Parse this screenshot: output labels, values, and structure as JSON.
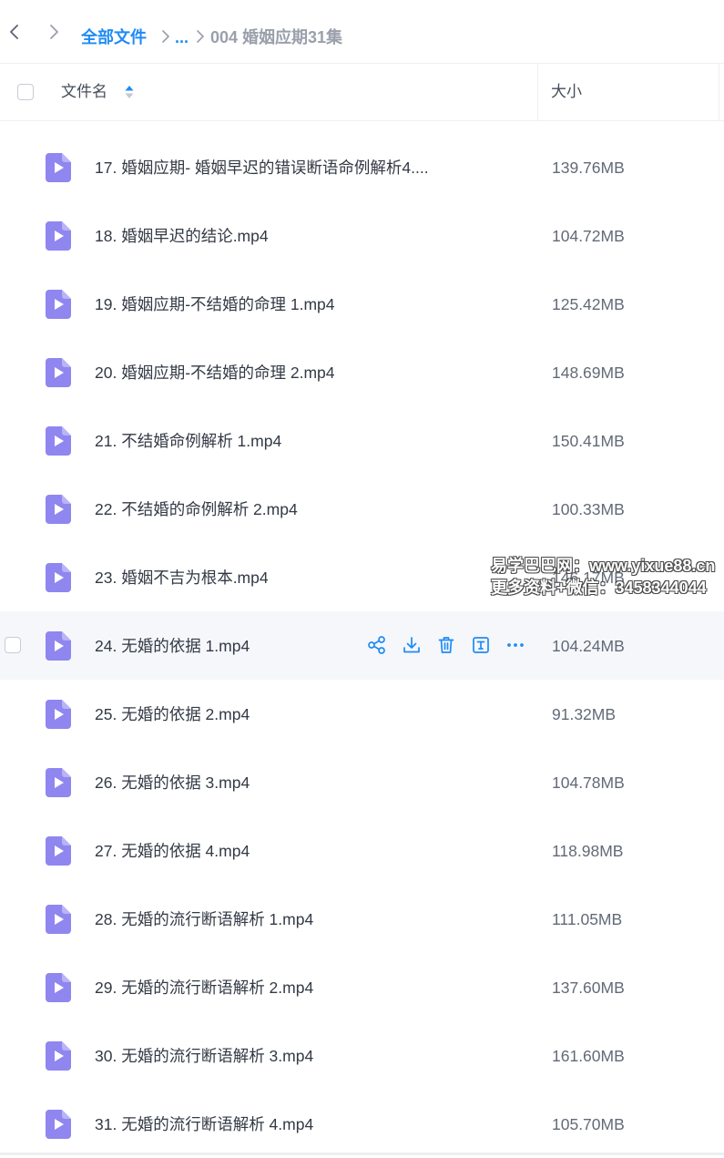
{
  "breadcrumb": {
    "root": "全部文件",
    "ellipsis": "...",
    "current": "004 婚姻应期31集"
  },
  "header": {
    "name_label": "文件名",
    "size_label": "大小"
  },
  "colors": {
    "accent": "#1f8bf5",
    "file_icon": "#8f86f0",
    "hover_row": "#f5f7fb"
  },
  "files": [
    {
      "name": "17. 婚姻应期- 婚姻早迟的错误断语命例解析4....",
      "size": "139.76MB"
    },
    {
      "name": "18. 婚姻早迟的结论.mp4",
      "size": "104.72MB"
    },
    {
      "name": "19. 婚姻应期-不结婚的命理 1.mp4",
      "size": "125.42MB"
    },
    {
      "name": "20. 婚姻应期-不结婚的命理 2.mp4",
      "size": "148.69MB"
    },
    {
      "name": "21. 不结婚命例解析 1.mp4",
      "size": "150.41MB"
    },
    {
      "name": "22. 不结婚的命例解析 2.mp4",
      "size": "100.33MB"
    },
    {
      "name": "23. 婚姻不吉为根本.mp4",
      "size": "146.17MB"
    },
    {
      "name": "24. 无婚的依据 1.mp4",
      "size": "104.24MB"
    },
    {
      "name": "25. 无婚的依据 2.mp4",
      "size": "91.32MB"
    },
    {
      "name": "26. 无婚的依据 3.mp4",
      "size": "104.78MB"
    },
    {
      "name": "27. 无婚的依据 4.mp4",
      "size": "118.98MB"
    },
    {
      "name": "28. 无婚的流行断语解析 1.mp4",
      "size": "111.05MB"
    },
    {
      "name": "29. 无婚的流行断语解析 2.mp4",
      "size": "137.60MB"
    },
    {
      "name": "30. 无婚的流行断语解析 3.mp4",
      "size": "161.60MB"
    },
    {
      "name": "31. 无婚的流行断语解析 4.mp4",
      "size": "105.70MB"
    }
  ],
  "hover_actions": [
    "share-icon",
    "download-icon",
    "trash-icon",
    "rename-icon",
    "more-icon"
  ],
  "watermark": {
    "line1": "易学巴巴网：www.yixue88.cn",
    "line2": "更多资料+微信：3458344044"
  }
}
